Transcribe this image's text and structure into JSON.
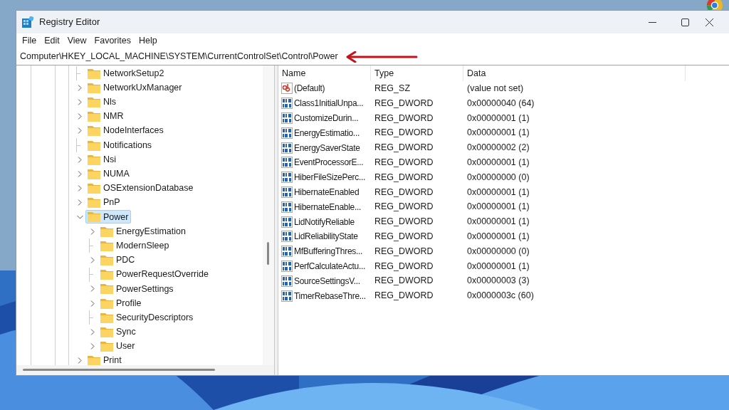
{
  "window": {
    "title": "Registry Editor"
  },
  "menu": [
    "File",
    "Edit",
    "View",
    "Favorites",
    "Help"
  ],
  "address": "Computer\\HKEY_LOCAL_MACHINE\\SYSTEM\\CurrentControlSet\\Control\\Power",
  "tree": [
    {
      "label": "NetworkSetup2",
      "expandable": false,
      "expanded": false,
      "selected": false
    },
    {
      "label": "NetworkUxManager",
      "expandable": true,
      "expanded": false,
      "selected": false
    },
    {
      "label": "Nls",
      "expandable": true,
      "expanded": false,
      "selected": false
    },
    {
      "label": "NMR",
      "expandable": true,
      "expanded": false,
      "selected": false
    },
    {
      "label": "NodeInterfaces",
      "expandable": true,
      "expanded": false,
      "selected": false
    },
    {
      "label": "Notifications",
      "expandable": false,
      "expanded": false,
      "selected": false
    },
    {
      "label": "Nsi",
      "expandable": true,
      "expanded": false,
      "selected": false
    },
    {
      "label": "NUMA",
      "expandable": true,
      "expanded": false,
      "selected": false
    },
    {
      "label": "OSExtensionDatabase",
      "expandable": true,
      "expanded": false,
      "selected": false
    },
    {
      "label": "PnP",
      "expandable": true,
      "expanded": false,
      "selected": false
    },
    {
      "label": "Power",
      "expandable": true,
      "expanded": true,
      "selected": true,
      "children": [
        {
          "label": "EnergyEstimation",
          "expandable": true,
          "expanded": false,
          "selected": false
        },
        {
          "label": "ModernSleep",
          "expandable": false,
          "expanded": false,
          "selected": false
        },
        {
          "label": "PDC",
          "expandable": true,
          "expanded": false,
          "selected": false
        },
        {
          "label": "PowerRequestOverride",
          "expandable": false,
          "expanded": false,
          "selected": false
        },
        {
          "label": "PowerSettings",
          "expandable": true,
          "expanded": false,
          "selected": false
        },
        {
          "label": "Profile",
          "expandable": true,
          "expanded": false,
          "selected": false
        },
        {
          "label": "SecurityDescriptors",
          "expandable": false,
          "expanded": false,
          "selected": false
        },
        {
          "label": "Sync",
          "expandable": true,
          "expanded": false,
          "selected": false
        },
        {
          "label": "User",
          "expandable": true,
          "expanded": false,
          "selected": false
        }
      ]
    },
    {
      "label": "Print",
      "expandable": true,
      "expanded": false,
      "selected": false
    }
  ],
  "table": {
    "columns": [
      "Name",
      "Type",
      "Data"
    ],
    "rows": [
      {
        "kind": "string",
        "name": "(Default)",
        "type": "REG_SZ",
        "data": "(value not set)"
      },
      {
        "kind": "dword",
        "name": "Class1InitialUnpa...",
        "type": "REG_DWORD",
        "data": "0x00000040 (64)"
      },
      {
        "kind": "dword",
        "name": "CustomizeDurin...",
        "type": "REG_DWORD",
        "data": "0x00000001 (1)"
      },
      {
        "kind": "dword",
        "name": "EnergyEstimatio...",
        "type": "REG_DWORD",
        "data": "0x00000001 (1)"
      },
      {
        "kind": "dword",
        "name": "EnergySaverState",
        "type": "REG_DWORD",
        "data": "0x00000002 (2)"
      },
      {
        "kind": "dword",
        "name": "EventProcessorE...",
        "type": "REG_DWORD",
        "data": "0x00000001 (1)"
      },
      {
        "kind": "dword",
        "name": "HiberFileSizePerc...",
        "type": "REG_DWORD",
        "data": "0x00000000 (0)"
      },
      {
        "kind": "dword",
        "name": "HibernateEnabled",
        "type": "REG_DWORD",
        "data": "0x00000001 (1)"
      },
      {
        "kind": "dword",
        "name": "HibernateEnable...",
        "type": "REG_DWORD",
        "data": "0x00000001 (1)"
      },
      {
        "kind": "dword",
        "name": "LidNotifyReliable",
        "type": "REG_DWORD",
        "data": "0x00000001 (1)"
      },
      {
        "kind": "dword",
        "name": "LidReliabilityState",
        "type": "REG_DWORD",
        "data": "0x00000001 (1)"
      },
      {
        "kind": "dword",
        "name": "MfBufferingThres...",
        "type": "REG_DWORD",
        "data": "0x00000000 (0)"
      },
      {
        "kind": "dword",
        "name": "PerfCalculateActu...",
        "type": "REG_DWORD",
        "data": "0x00000001 (1)"
      },
      {
        "kind": "dword",
        "name": "SourceSettingsV...",
        "type": "REG_DWORD",
        "data": "0x00000003 (3)"
      },
      {
        "kind": "dword",
        "name": "TimerRebaseThre...",
        "type": "REG_DWORD",
        "data": "0x0000003c (60)"
      }
    ]
  }
}
